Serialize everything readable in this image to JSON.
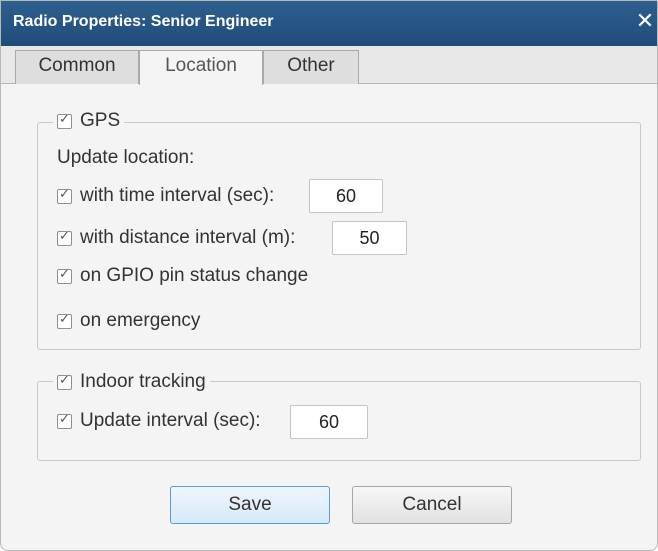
{
  "window": {
    "title": "Radio Properties: Senior Engineer",
    "close_glyph": "✕"
  },
  "tabs": [
    {
      "label": "Common",
      "selected": false
    },
    {
      "label": "Location",
      "selected": true
    },
    {
      "label": "Other",
      "selected": false
    }
  ],
  "gps": {
    "label": "GPS",
    "checked": true,
    "update_location_label": "Update location:",
    "time_interval": {
      "label": "with time interval (sec):",
      "checked": true,
      "value": "60"
    },
    "distance_interval": {
      "label": "with distance interval (m):",
      "checked": true,
      "value": "50"
    },
    "gpio": {
      "label": "on GPIO pin status change",
      "checked": true
    },
    "emergency": {
      "label": "on emergency",
      "checked": true
    }
  },
  "indoor": {
    "label": "Indoor tracking",
    "checked": true,
    "update_interval": {
      "label": "Update interval (sec):",
      "checked": true,
      "value": "60"
    }
  },
  "buttons": {
    "save": "Save",
    "cancel": "Cancel"
  },
  "check_glyph": "✓",
  "colors": {
    "titlebar": "#1e4d7b",
    "save_border": "#5b9bd5"
  }
}
